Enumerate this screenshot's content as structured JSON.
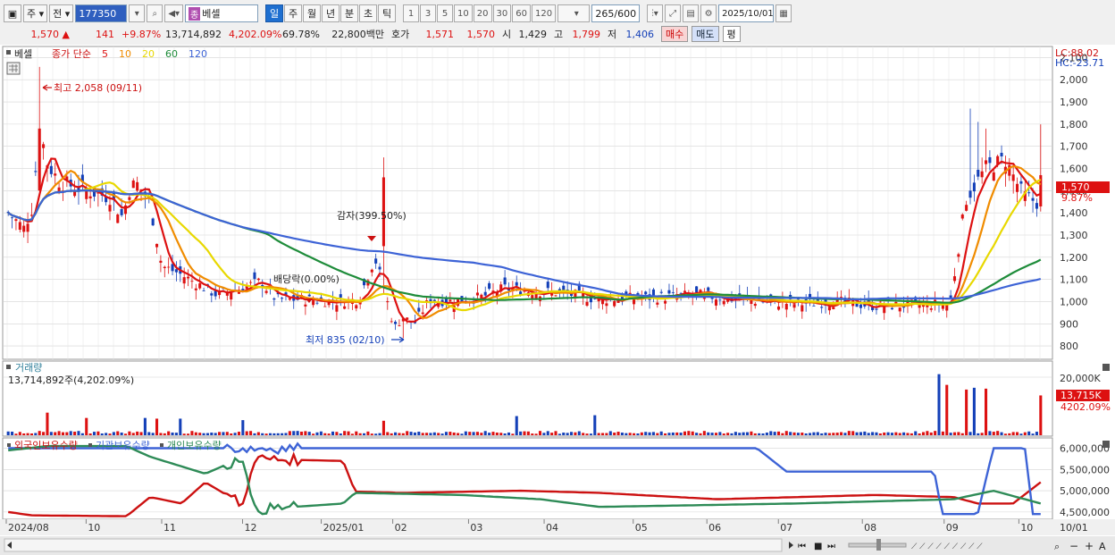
{
  "toolbar": {
    "period_select": "주",
    "prev_label": "전",
    "code_value": "177350",
    "name_value": "베셀",
    "name_badge": "종",
    "periods": [
      "일",
      "주",
      "월",
      "년",
      "분",
      "초",
      "틱"
    ],
    "active_period": "일",
    "intervals": [
      "1",
      "3",
      "5",
      "10",
      "20",
      "30",
      "60",
      "120"
    ],
    "count_value": "265",
    "count_total": "/600",
    "date_value": "2025/10/01"
  },
  "quote": {
    "price": "1,570",
    "change_arrow": "▲",
    "change": "141",
    "change_pct": "+9.87%",
    "volume": "13,714,892",
    "volume_ratio": "4,202.09%",
    "turnover_rate": "69.78%",
    "amount": "22,800백만",
    "hoga_label": "호가",
    "ask": "1,571",
    "bid": "1,570",
    "open_label": "시",
    "open": "1,429",
    "high_label": "고",
    "high": "1,799",
    "low_label": "저",
    "low": "1,406",
    "buy_label": "매수",
    "sell_label": "매도",
    "eval_label": "평"
  },
  "price_panel": {
    "title": "베셀",
    "ma_label": "종가 단순",
    "mas": [
      {
        "period": "5",
        "color": "#dd1111"
      },
      {
        "period": "10",
        "color": "#f08c00"
      },
      {
        "period": "20",
        "color": "#e8d800"
      },
      {
        "period": "60",
        "color": "#1e8c3a"
      },
      {
        "period": "120",
        "color": "#3d63d6"
      }
    ],
    "lc": "LC:88.02",
    "hc": "HC:-23.71",
    "y_ticks": [
      "2,100",
      "2,000",
      "1,900",
      "1,800",
      "1,700",
      "1,600",
      "1,500",
      "1,400",
      "1,300",
      "1,200",
      "1,100",
      "1,000",
      "900",
      "800"
    ],
    "current_price": "1,570",
    "current_pct": "9.87%",
    "annotations": {
      "high": "최고 2,058 (09/11)",
      "low": "최저 835 (02/10)",
      "capital_reduction": "감자(399.50%)",
      "ex_dividend": "배당락(0.00%)"
    }
  },
  "volume_panel": {
    "title": "거래량",
    "info": "13,714,892주(4,202.09%)",
    "y_tick": "20,000K",
    "current": "13,715K",
    "current_pct": "4202.09%"
  },
  "holding_panel": {
    "legend": [
      {
        "label": "외국인보유수량",
        "color": "#cc1111"
      },
      {
        "label": "기관보유수량",
        "color": "#3d63d6"
      },
      {
        "label": "개인보유수량",
        "color": "#2e8b57"
      }
    ],
    "y_ticks": [
      "6,000,000",
      "5,500,000",
      "5,000,000",
      "4,500,000"
    ]
  },
  "x_axis": {
    "labels": [
      "2024/08",
      "10",
      "11",
      "12",
      "2025/01",
      "02",
      "03",
      "04",
      "05",
      "06",
      "07",
      "08",
      "09",
      "10",
      "10/01"
    ]
  },
  "colors": {
    "up": "#dd1111",
    "down": "#1440b8",
    "grid": "#d4d4d4",
    "price_box": "#dd1111"
  }
}
